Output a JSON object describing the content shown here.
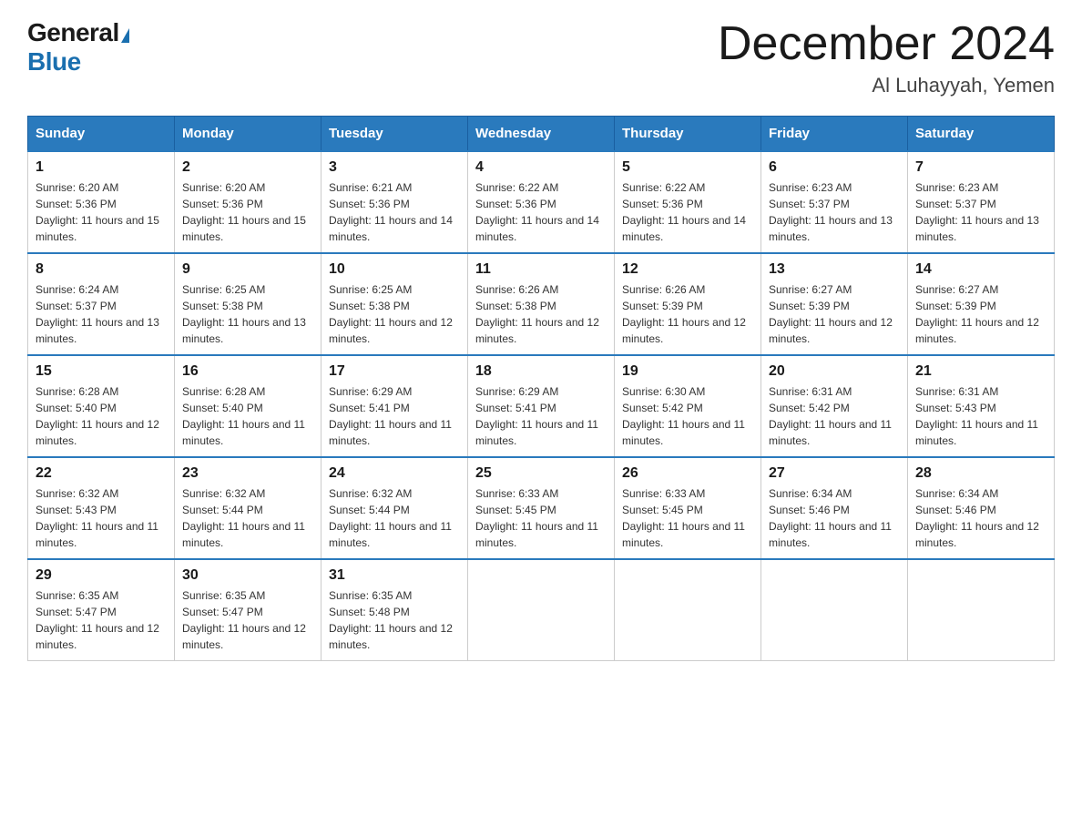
{
  "header": {
    "logo_general": "General",
    "logo_blue": "Blue",
    "month_title": "December 2024",
    "location": "Al Luhayyah, Yemen"
  },
  "days_of_week": [
    "Sunday",
    "Monday",
    "Tuesday",
    "Wednesday",
    "Thursday",
    "Friday",
    "Saturday"
  ],
  "weeks": [
    [
      {
        "day": "1",
        "sunrise": "6:20 AM",
        "sunset": "5:36 PM",
        "daylight": "11 hours and 15 minutes."
      },
      {
        "day": "2",
        "sunrise": "6:20 AM",
        "sunset": "5:36 PM",
        "daylight": "11 hours and 15 minutes."
      },
      {
        "day": "3",
        "sunrise": "6:21 AM",
        "sunset": "5:36 PM",
        "daylight": "11 hours and 14 minutes."
      },
      {
        "day": "4",
        "sunrise": "6:22 AM",
        "sunset": "5:36 PM",
        "daylight": "11 hours and 14 minutes."
      },
      {
        "day": "5",
        "sunrise": "6:22 AM",
        "sunset": "5:36 PM",
        "daylight": "11 hours and 14 minutes."
      },
      {
        "day": "6",
        "sunrise": "6:23 AM",
        "sunset": "5:37 PM",
        "daylight": "11 hours and 13 minutes."
      },
      {
        "day": "7",
        "sunrise": "6:23 AM",
        "sunset": "5:37 PM",
        "daylight": "11 hours and 13 minutes."
      }
    ],
    [
      {
        "day": "8",
        "sunrise": "6:24 AM",
        "sunset": "5:37 PM",
        "daylight": "11 hours and 13 minutes."
      },
      {
        "day": "9",
        "sunrise": "6:25 AM",
        "sunset": "5:38 PM",
        "daylight": "11 hours and 13 minutes."
      },
      {
        "day": "10",
        "sunrise": "6:25 AM",
        "sunset": "5:38 PM",
        "daylight": "11 hours and 12 minutes."
      },
      {
        "day": "11",
        "sunrise": "6:26 AM",
        "sunset": "5:38 PM",
        "daylight": "11 hours and 12 minutes."
      },
      {
        "day": "12",
        "sunrise": "6:26 AM",
        "sunset": "5:39 PM",
        "daylight": "11 hours and 12 minutes."
      },
      {
        "day": "13",
        "sunrise": "6:27 AM",
        "sunset": "5:39 PM",
        "daylight": "11 hours and 12 minutes."
      },
      {
        "day": "14",
        "sunrise": "6:27 AM",
        "sunset": "5:39 PM",
        "daylight": "11 hours and 12 minutes."
      }
    ],
    [
      {
        "day": "15",
        "sunrise": "6:28 AM",
        "sunset": "5:40 PM",
        "daylight": "11 hours and 12 minutes."
      },
      {
        "day": "16",
        "sunrise": "6:28 AM",
        "sunset": "5:40 PM",
        "daylight": "11 hours and 11 minutes."
      },
      {
        "day": "17",
        "sunrise": "6:29 AM",
        "sunset": "5:41 PM",
        "daylight": "11 hours and 11 minutes."
      },
      {
        "day": "18",
        "sunrise": "6:29 AM",
        "sunset": "5:41 PM",
        "daylight": "11 hours and 11 minutes."
      },
      {
        "day": "19",
        "sunrise": "6:30 AM",
        "sunset": "5:42 PM",
        "daylight": "11 hours and 11 minutes."
      },
      {
        "day": "20",
        "sunrise": "6:31 AM",
        "sunset": "5:42 PM",
        "daylight": "11 hours and 11 minutes."
      },
      {
        "day": "21",
        "sunrise": "6:31 AM",
        "sunset": "5:43 PM",
        "daylight": "11 hours and 11 minutes."
      }
    ],
    [
      {
        "day": "22",
        "sunrise": "6:32 AM",
        "sunset": "5:43 PM",
        "daylight": "11 hours and 11 minutes."
      },
      {
        "day": "23",
        "sunrise": "6:32 AM",
        "sunset": "5:44 PM",
        "daylight": "11 hours and 11 minutes."
      },
      {
        "day": "24",
        "sunrise": "6:32 AM",
        "sunset": "5:44 PM",
        "daylight": "11 hours and 11 minutes."
      },
      {
        "day": "25",
        "sunrise": "6:33 AM",
        "sunset": "5:45 PM",
        "daylight": "11 hours and 11 minutes."
      },
      {
        "day": "26",
        "sunrise": "6:33 AM",
        "sunset": "5:45 PM",
        "daylight": "11 hours and 11 minutes."
      },
      {
        "day": "27",
        "sunrise": "6:34 AM",
        "sunset": "5:46 PM",
        "daylight": "11 hours and 11 minutes."
      },
      {
        "day": "28",
        "sunrise": "6:34 AM",
        "sunset": "5:46 PM",
        "daylight": "11 hours and 12 minutes."
      }
    ],
    [
      {
        "day": "29",
        "sunrise": "6:35 AM",
        "sunset": "5:47 PM",
        "daylight": "11 hours and 12 minutes."
      },
      {
        "day": "30",
        "sunrise": "6:35 AM",
        "sunset": "5:47 PM",
        "daylight": "11 hours and 12 minutes."
      },
      {
        "day": "31",
        "sunrise": "6:35 AM",
        "sunset": "5:48 PM",
        "daylight": "11 hours and 12 minutes."
      },
      null,
      null,
      null,
      null
    ]
  ]
}
